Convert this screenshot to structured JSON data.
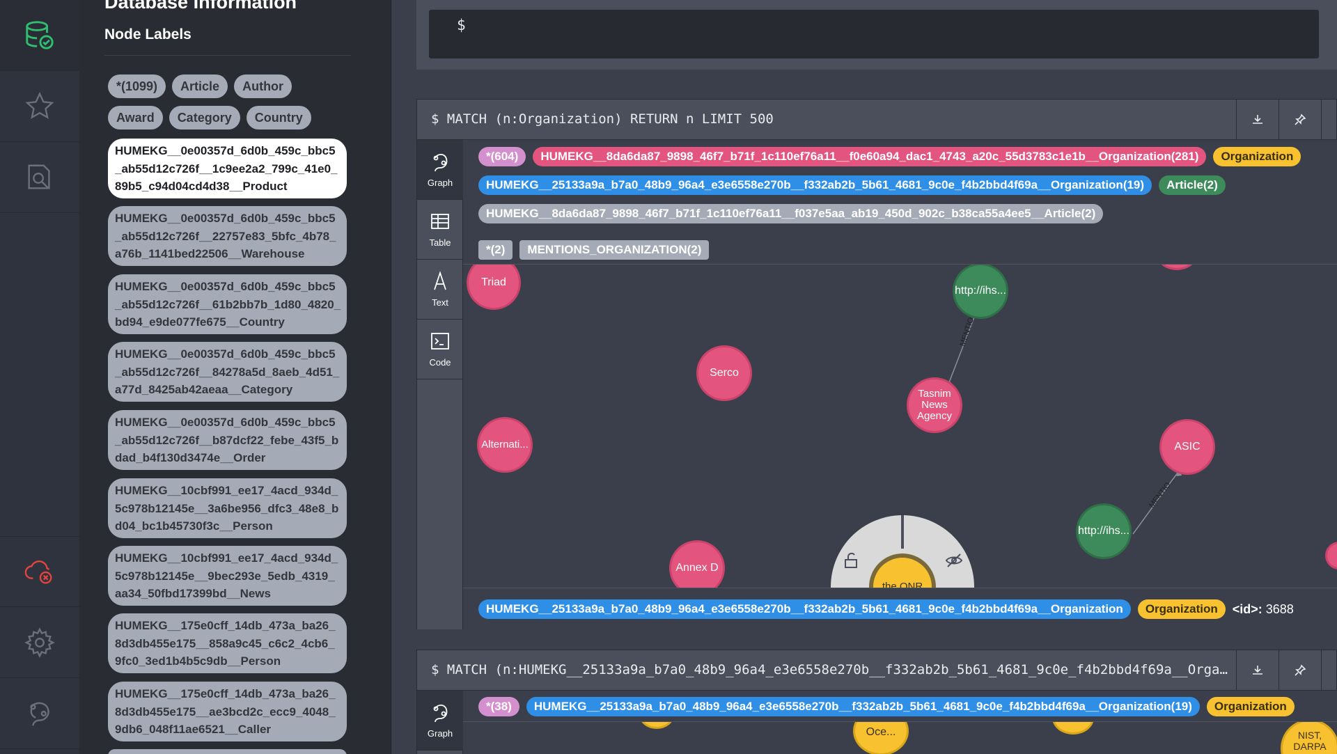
{
  "sidebar": {
    "title": "Database Information",
    "node_labels_heading": "Node Labels",
    "label_pills": [
      "*(1099)",
      "Article",
      "Author",
      "Award",
      "Category",
      "Country"
    ],
    "long_labels": [
      "HUMEKG__0e00357d_6d0b_459c_bbc5_ab55d12c726f__1c9ee2a2_799c_41e0_89b5_c94d04cd4d38__Product",
      "HUMEKG__0e00357d_6d0b_459c_bbc5_ab55d12c726f__22757e83_5bfc_4b78_a76b_1141bed22506__Warehouse",
      "HUMEKG__0e00357d_6d0b_459c_bbc5_ab55d12c726f__61b2bb7b_1d80_4820_bd94_e9de077fe675__Country",
      "HUMEKG__0e00357d_6d0b_459c_bbc5_ab55d12c726f__84278a5d_8aeb_4d51_a77d_8425ab42aeaa__Category",
      "HUMEKG__0e00357d_6d0b_459c_bbc5_ab55d12c726f__b87dcf22_febe_43f5_bdad_b4f130d3474e__Order",
      "HUMEKG__10cbf991_ee17_4acd_934d_5c978b12145e__3a6be956_dfc3_48e8_bd04_bc1b45730f3c__Person",
      "HUMEKG__10cbf991_ee17_4acd_934d_5c978b12145e__9bec293e_5edb_4319_aa34_50fbd17399bd__News",
      "HUMEKG__175e0cff_14db_473a_ba26_8d3db455e175__858a9c45_c6c2_4cb6_9fc0_3ed1b4b5c9db__Person",
      "HUMEKG__175e0cff_14db_473a_ba26_8d3db455e175__ae3bcd2c_ecc9_4048_9db6_048f11ae6521__Caller"
    ]
  },
  "editor": {
    "prompt": "$"
  },
  "frame1": {
    "query": "$ MATCH (n:Organization) RETURN n LIMIT 500",
    "view_tabs": [
      "Graph",
      "Table",
      "Text",
      "Code"
    ],
    "node_chips_row1": [
      {
        "text": "*(604)",
        "color": "lilac"
      },
      {
        "text": "HUMEKG__8da6da87_9898_46f7_b71f_1c110ef76a11__f0e60a94_dac1_4743_a20c_55d3783c1e1b__Organization(281)",
        "color": "pink"
      },
      {
        "text": "Organization",
        "color": "yellow"
      }
    ],
    "node_chips_row2": [
      {
        "text": "HUMEKG__25133a9a_b7a0_48b9_96a4_e3e6558e270b__f332ab2b_5b61_4681_9c0e_f4b2bbd4f69a__Organization(19)",
        "color": "blue"
      },
      {
        "text": "Article(2)",
        "color": "green"
      }
    ],
    "node_chips_row3": [
      {
        "text": "HUMEKG__8da6da87_9898_46f7_b71f_1c110ef76a11__f037e5aa_ab19_450d_902c_b38ca55a4ee5__Article(2)",
        "color": "grey-round"
      }
    ],
    "rel_chips": [
      "*(2)",
      "MENTIONS_ORGANIZATION(2)"
    ],
    "nodes": {
      "triad": "Triad",
      "http1": "http://ihs...",
      "serco": "Serco",
      "tasnim": "Tasnim News Agency",
      "alternati": "Alternati...",
      "asic": "ASIC",
      "http2": "http://ihs...",
      "annex": "Annex D",
      "onr": "the ONR"
    },
    "edge_labels": [
      "MENTIO...",
      "MENTIO..."
    ],
    "status": {
      "label_chip": "HUMEKG__25133a9a_b7a0_48b9_96a4_e3e6558e270b__f332ab2b_5b61_4681_9c0e_f4b2bbd4f69a__Organization",
      "org_chip": "Organization",
      "id_key": "<id>:",
      "id_value": "3688"
    }
  },
  "frame2": {
    "query": "$ MATCH (n:HUMEKG__25133a9a_b7a0_48b9_96a4_e3e6558e270b__f332ab2b_5b61_4681_9c0e_f4b2bbd4f69a__Organization) RETURN n LIMIT 500",
    "view_tab": "Graph",
    "chips": [
      {
        "text": "*(38)",
        "color": "lilac"
      },
      {
        "text": "HUMEKG__25133a9a_b7a0_48b9_96a4_e3e6558e270b__f332ab2b_5b61_4681_9c0e_f4b2bbd4f69a__Organization(19)",
        "color": "blue"
      },
      {
        "text": "Organization",
        "color": "yellow"
      }
    ],
    "nodes": {
      "oce": "Oce...",
      "nist": "NIST, DARPA"
    }
  }
}
